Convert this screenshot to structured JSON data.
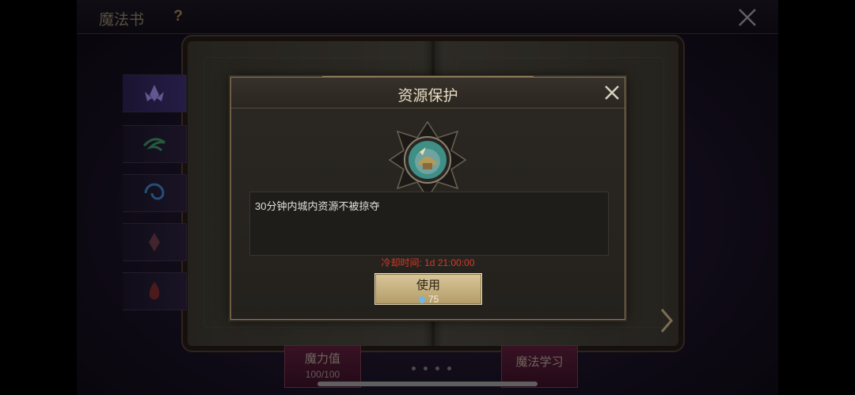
{
  "screen": {
    "title": "魔法书",
    "help_label": "?",
    "bottom_tabs": [
      {
        "label": "魔力值",
        "sub": "100/100"
      },
      {
        "label": "魔法学习"
      }
    ]
  },
  "dialog": {
    "title": "资源保护",
    "description": "30分钟内城内资源不被掠夺",
    "cooldown": "冷却时间: 1d 21:00:00",
    "use_button": {
      "label": "使用",
      "cost": "75"
    }
  },
  "colors": {
    "accent_gold": "#8d7a56",
    "cooldown_red": "#d83a2a",
    "button_gold": "#d8c69a"
  },
  "icons": [
    "close-icon",
    "help-icon",
    "resource-protection-icon",
    "gem-icon",
    "next-page-icon"
  ]
}
